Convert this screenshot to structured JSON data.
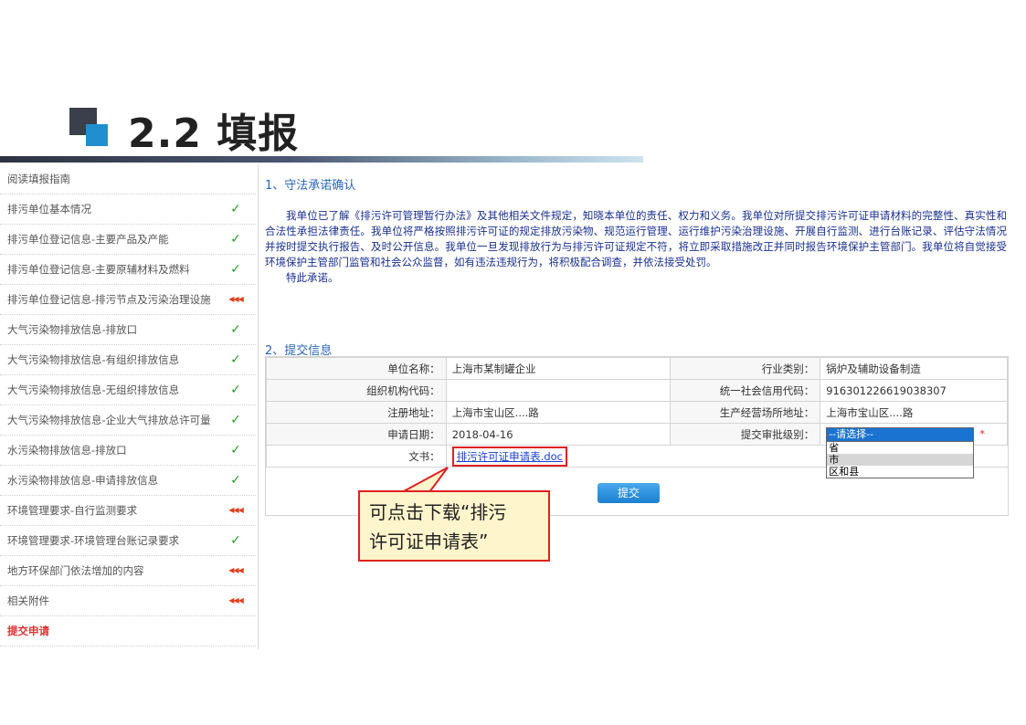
{
  "slide": {
    "title": "2.2  填报"
  },
  "sidebar": {
    "items": [
      {
        "label": "阅读填报指南",
        "status": ""
      },
      {
        "label": "排污单位基本情况",
        "status": "ok"
      },
      {
        "label": "排污单位登记信息-主要产品及产能",
        "status": "ok"
      },
      {
        "label": "排污单位登记信息-主要原辅材料及燃料",
        "status": "ok"
      },
      {
        "label": "排污单位登记信息-排污节点及污染治理设施",
        "status": "pending"
      },
      {
        "label": "大气污染物排放信息-排放口",
        "status": "ok"
      },
      {
        "label": "大气污染物排放信息-有组织排放信息",
        "status": "ok"
      },
      {
        "label": "大气污染物排放信息-无组织排放信息",
        "status": "ok"
      },
      {
        "label": "大气污染物排放信息-企业大气排放总许可量",
        "status": "ok"
      },
      {
        "label": "水污染物排放信息-排放口",
        "status": "ok"
      },
      {
        "label": "水污染物排放信息-申请排放信息",
        "status": "ok"
      },
      {
        "label": "环境管理要求-自行监测要求",
        "status": "pending"
      },
      {
        "label": "环境管理要求-环境管理台账记录要求",
        "status": "ok"
      },
      {
        "label": "地方环保部门依法增加的内容",
        "status": "pending"
      },
      {
        "label": "相关附件",
        "status": "pending"
      },
      {
        "label": "提交申请",
        "status": "",
        "active": true
      }
    ],
    "ok_glyph": "✓",
    "pending_glyph": "◀◀◀"
  },
  "section1": {
    "title": "1、守法承诺确认",
    "paragraph": "我单位已了解《排污许可管理暂行办法》及其他相关文件规定，知晓本单位的责任、权力和义务。我单位对所提交排污许可证申请材料的完整性、真实性和合法性承担法律责任。我单位将严格按照排污许可证的规定排放污染物、规范运行管理、运行维护污染治理设施、开展自行监测、进行台账记录、评估守法情况并按时提交执行报告、及时公开信息。我单位一旦发现排放行为与排污许可证规定不符，将立即采取措施改正并同时报告环境保护主管部门。我单位将自觉接受环境保护主管部门监管和社会公众监督，如有违法违规行为，将积极配合调查，并依法接受处罚。",
    "closing": "特此承诺。"
  },
  "section2": {
    "title": "2、提交信息",
    "rows": [
      {
        "l1": "单位名称：",
        "v1": "上海市某制罐企业",
        "l2": "行业类别：",
        "v2": "锅炉及辅助设备制造"
      },
      {
        "l1": "组织机构代码：",
        "v1": "",
        "l2": "统一社会信用代码：",
        "v2": "916301226619038307"
      },
      {
        "l1": "注册地址：",
        "v1": "上海市宝山区....路",
        "l2": "生产经营场所地址：",
        "v2": "上海市宝山区....路"
      },
      {
        "l1": "申请日期：",
        "v1": "2018-04-16",
        "l2": "提交审批级别：",
        "v2": ""
      }
    ],
    "doc_label": "文书：",
    "doc_link": "排污许可证申请表.doc",
    "required_mark": "*",
    "select": {
      "selected": "--请选择--",
      "options": [
        "省",
        "市",
        "区和县"
      ],
      "highlighted_index": 1
    },
    "submit_label": "提交"
  },
  "callout": {
    "text_line1": "可点击下载“排污",
    "text_line2": "许可证申请表”"
  },
  "colors": {
    "accent_blue": "#1a73d0",
    "callout_border": "#e02020",
    "callout_fill": "#fff5cc",
    "ok_green": "#2a9a2a"
  }
}
